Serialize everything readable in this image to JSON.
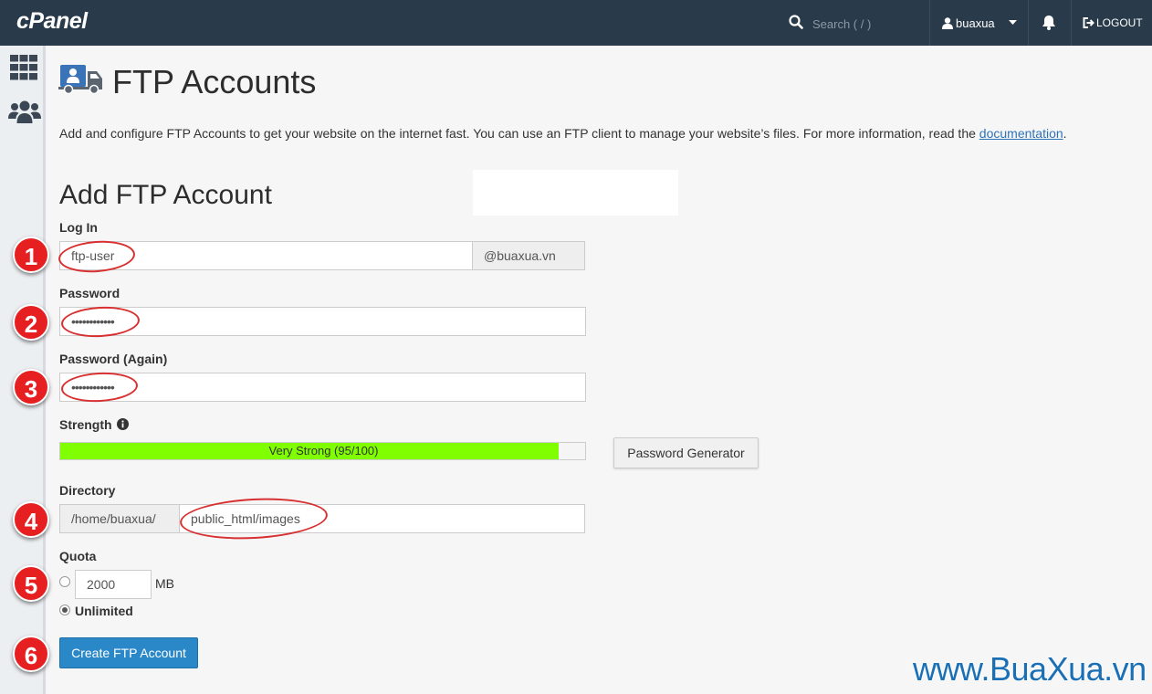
{
  "topbar": {
    "logo": "cPanel",
    "search_placeholder": "Search ( / )",
    "username": "buaxua",
    "logout_label": "LOGOUT"
  },
  "page": {
    "title": "FTP Accounts",
    "description": "Add and configure FTP Accounts to get your website on the internet fast. You can use an FTP client to manage your website’s files. For more information, read the",
    "doc_link": "documentation"
  },
  "form": {
    "section_title": "Add FTP Account",
    "login_label": "Log In",
    "login_value": "ftp-user",
    "domain_suffix": "@buaxua.vn",
    "password_label": "Password",
    "password_value": "••••••••••••",
    "password_again_label": "Password (Again)",
    "password_again_value": "••••••••••••",
    "strength_label": "Strength",
    "strength_text": "Very Strong (95/100)",
    "strength_fill_fraction": 0.95,
    "strength_color": "#7fff00",
    "password_generator_label": "Password Generator",
    "directory_label": "Directory",
    "directory_prefix": "/home/buaxua/",
    "directory_value": "public_html/images",
    "quota_label": "Quota",
    "quota_value": "2000",
    "quota_unit": "MB",
    "unlimited_label": "Unlimited",
    "quota_selected": "unlimited",
    "submit_label": "Create FTP Account"
  },
  "annotations": {
    "steps": [
      "1",
      "2",
      "3",
      "4",
      "5",
      "6"
    ],
    "watermark": "www.BuaXua.vn"
  },
  "colors": {
    "topbar": "#293a4a",
    "primary_button": "#2a87c8",
    "step_badge": "#e62020"
  }
}
